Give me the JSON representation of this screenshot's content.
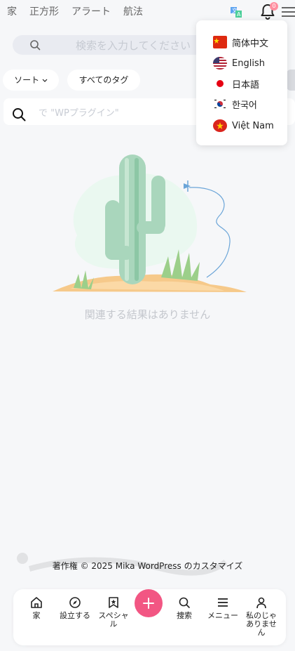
{
  "topnav": [
    "家",
    "正方形",
    "アラート",
    "航法"
  ],
  "notifications": {
    "badge": "0"
  },
  "search": {
    "placeholder": "検索を入力してください"
  },
  "filters": {
    "sort_label": "ソート",
    "tags_label": "すべてのタグ"
  },
  "search_card": {
    "placeholder": "で \"WPプラグイン\""
  },
  "empty": {
    "message": "関連する結果はありません"
  },
  "languages": [
    {
      "label": "简体中文",
      "flag": "cn-flag-icon"
    },
    {
      "label": "English",
      "flag": "us-flag-icon"
    },
    {
      "label": "日本語",
      "flag": "jp-flag-icon"
    },
    {
      "label": "한국어",
      "flag": "kr-flag-icon"
    },
    {
      "label": "Việt Nam",
      "flag": "vn-flag-icon"
    }
  ],
  "footer": {
    "copyright": "著作権 © 2025 Mika WordPress のカスタマイズ"
  },
  "bottom_nav": [
    "家",
    "設立する",
    "スペシャル",
    "捜索",
    "メニュー",
    "私のじゃありません"
  ],
  "colors": {
    "accent": "#f25683",
    "background": "#f6f7f9"
  }
}
